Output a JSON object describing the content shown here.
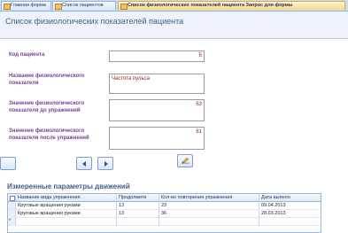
{
  "tabs": [
    {
      "label": "Главная форма"
    },
    {
      "label": "Список пациентов"
    },
    {
      "label": "Список физиологических показателей пациента Запрос для формы"
    }
  ],
  "form": {
    "title": "Список физиологических показателей пациента",
    "fields": {
      "patient_code": {
        "label": "Код пациента",
        "value": "5"
      },
      "indicator_name": {
        "label": "Название физиологического показателя",
        "value": "Частота пульса"
      },
      "value_before": {
        "label": "Значение физиологического показателя до упражнений",
        "value": "63"
      },
      "value_after": {
        "label": "Значение физиологического показателя после упражнений",
        "value": "81"
      }
    }
  },
  "subform": {
    "title": "Измеренные параметры движений",
    "columns": [
      "Название вида упражнения",
      "Продолжите",
      "Кол-во повторения упражнения",
      "Дата выполн"
    ],
    "rows": [
      [
        "Круговые вращения руками",
        "13",
        "23",
        "09.04.2013"
      ],
      [
        "Круговые вращения руками",
        "13",
        "36",
        "28.03.2013"
      ]
    ],
    "new_row_marker": "*"
  },
  "colors": {
    "label_color": "#7a3f96",
    "value_color": "#8b1d1d",
    "title_color": "#3f5f8f"
  },
  "icons": {
    "prev": "triangle-left-icon",
    "next": "triangle-right-icon",
    "edit": "pencil-icon"
  }
}
